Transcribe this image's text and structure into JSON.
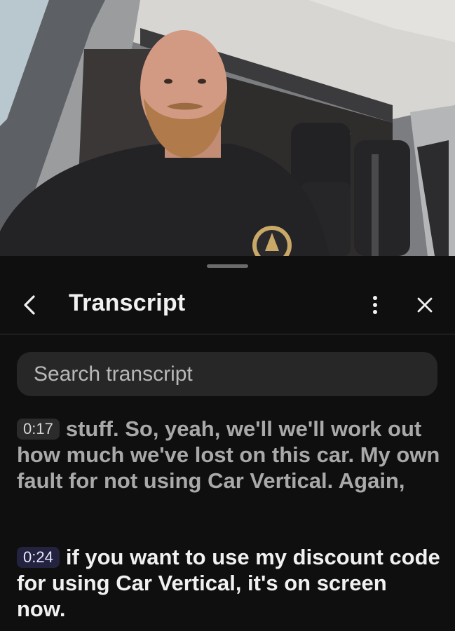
{
  "video": {
    "description_icon": "person-talking-in-car"
  },
  "panel": {
    "title": "Transcript",
    "icons": {
      "back": "chevron-left-icon",
      "more": "vertical-dots-icon",
      "close": "close-icon"
    },
    "search": {
      "placeholder": "Search transcript",
      "value": ""
    },
    "segments": [
      {
        "timestamp": "0:17",
        "text": "stuff. So, yeah, we'll we'll work out how much we've lost on this car. My own fault for not using Car Vertical. Again,",
        "active": false
      },
      {
        "timestamp": "0:24",
        "text": "if you want to use my discount code for using Car Vertical, it's on screen now.",
        "active": true
      }
    ]
  },
  "colors": {
    "background": "#0f0f0f",
    "search_bg": "#272727",
    "active_text": "#f1f1f1",
    "inactive_text": "#a9a9a9",
    "active_timestamp_bg": "#23233f"
  }
}
